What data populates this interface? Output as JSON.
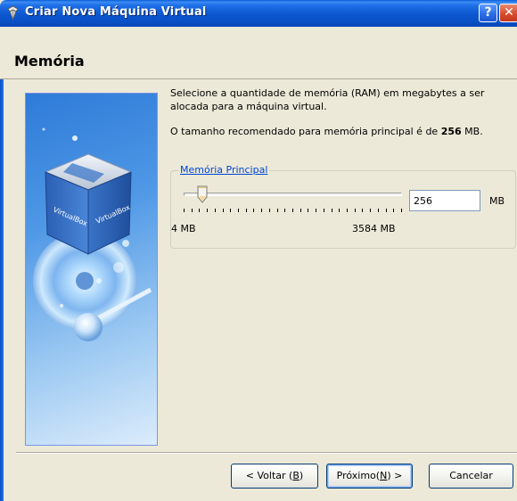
{
  "window": {
    "title": "Criar Nova Máquina Virtual",
    "help_label": "?",
    "close_label": "✕"
  },
  "header": {
    "title": "Memória"
  },
  "content": {
    "description": "Selecione a quantidade de memória (RAM) em megabytes a ser alocada para a máquina virtual.",
    "recommended_prefix": "O tamanho recomendado para memória principal é de ",
    "recommended_value": "256",
    "recommended_suffix": " MB."
  },
  "memory_group": {
    "legend": "Memória Principal",
    "value": "256",
    "unit": "MB",
    "min_label": "4 MB",
    "max_label": "3584 MB",
    "slider_min": 4,
    "slider_max": 3584,
    "slider_value": 256
  },
  "buttons": {
    "back_pre": "< Voltar (",
    "back_key": "B",
    "back_post": ")",
    "next_pre": "Próximo(",
    "next_key": "N",
    "next_post": ") >",
    "cancel": "Cancelar"
  },
  "colors": {
    "titlebar": "#0a4fc4",
    "dialog_bg": "#ece9d8",
    "legend": "#0046d5"
  }
}
